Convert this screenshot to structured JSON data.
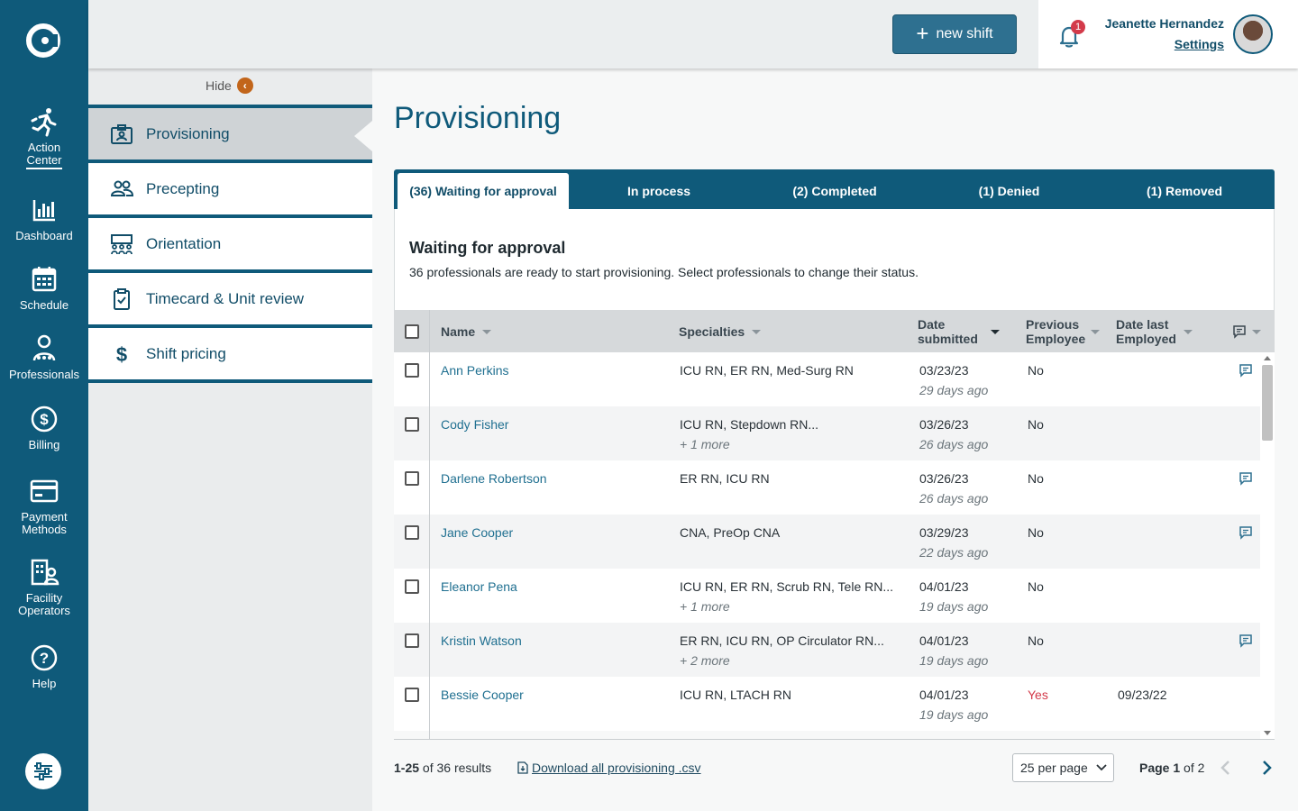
{
  "rail": {
    "items": [
      {
        "label_1": "Action",
        "label_2": "Center",
        "icon": "running-person-icon"
      },
      {
        "label_1": "Dashboard",
        "icon": "bar-chart-icon"
      },
      {
        "label_1": "Schedule",
        "icon": "calendar-icon"
      },
      {
        "label_1": "Professionals",
        "icon": "people-icon"
      },
      {
        "label_1": "Billing",
        "icon": "dollar-icon"
      },
      {
        "label_1": "Payment",
        "label_2": "Methods",
        "icon": "credit-card-icon"
      },
      {
        "label_1": "Facility",
        "label_2": "Operators",
        "icon": "building-person-icon"
      },
      {
        "label_1": "Help",
        "icon": "help-icon"
      }
    ]
  },
  "header": {
    "new_shift_label": "new shift",
    "notification_count": "1",
    "user_name": "Jeanette Hernandez",
    "settings_label": "Settings"
  },
  "subnav": {
    "hide_label": "Hide",
    "items": [
      {
        "label": "Provisioning",
        "icon": "id-badge-icon",
        "active": true
      },
      {
        "label": "Precepting",
        "icon": "two-people-icon"
      },
      {
        "label": "Orientation",
        "icon": "group-icon"
      },
      {
        "label": "Timecard & Unit review",
        "icon": "clipboard-check-icon"
      },
      {
        "label": "Shift pricing",
        "icon": "dollar-sign-icon"
      }
    ]
  },
  "main": {
    "title": "Provisioning",
    "tabs": [
      {
        "label": "(36) Waiting for approval",
        "active": true
      },
      {
        "label": "In process"
      },
      {
        "label": "(2) Completed"
      },
      {
        "label": "(1) Denied"
      },
      {
        "label": "(1) Removed"
      }
    ],
    "panel_title": "Waiting for approval",
    "panel_text": "36 professionals are ready to start provisioning. Select professionals to change their status."
  },
  "table": {
    "headers": {
      "name": "Name",
      "specialties": "Specialties",
      "date_submitted_1": "Date",
      "date_submitted_2": "submitted",
      "previous_1": "Previous",
      "previous_2": "Employee",
      "last_employed_1": "Date last",
      "last_employed_2": "Employed"
    },
    "rows": [
      {
        "name": "Ann Perkins",
        "specialties": "ICU RN, ER RN, Med-Surg RN",
        "more": "",
        "date": "03/23/23",
        "ago": "29 days ago",
        "previous": "No",
        "last_employed": "",
        "has_note": true
      },
      {
        "name": "Cody Fisher",
        "specialties": "ICU RN, Stepdown RN...",
        "more": "+ 1 more",
        "date": "03/26/23",
        "ago": "26 days ago",
        "previous": "No",
        "last_employed": "",
        "has_note": false
      },
      {
        "name": "Darlene Robertson",
        "specialties": "ER RN, ICU RN",
        "more": "",
        "date": "03/26/23",
        "ago": "26 days ago",
        "previous": "No",
        "last_employed": "",
        "has_note": true
      },
      {
        "name": "Jane Cooper",
        "specialties": "CNA, PreOp CNA",
        "more": "",
        "date": "03/29/23",
        "ago": "22 days ago",
        "previous": "No",
        "last_employed": "",
        "has_note": true
      },
      {
        "name": "Eleanor Pena",
        "specialties": "ICU RN, ER RN, Scrub RN, Tele RN...",
        "more": "+ 1 more",
        "date": "04/01/23",
        "ago": "19 days ago",
        "previous": "No",
        "last_employed": "",
        "has_note": false
      },
      {
        "name": "Kristin Watson",
        "specialties": "ER RN, ICU RN, OP Circulator RN...",
        "more": "+ 2 more",
        "date": "04/01/23",
        "ago": "19 days ago",
        "previous": "No",
        "last_employed": "",
        "has_note": true
      },
      {
        "name": "Bessie Cooper",
        "specialties": "ICU RN, LTACH RN",
        "more": "",
        "date": "04/01/23",
        "ago": "19 days ago",
        "previous": "Yes",
        "last_employed": "09/23/22",
        "has_note": false
      }
    ]
  },
  "footer": {
    "range": "1-25",
    "of_results": "of 36 results",
    "download_label": "Download all provisioning .csv",
    "per_page": "25 per page",
    "page_label": "Page",
    "page_current": "1",
    "page_of": "of 2"
  },
  "colors": {
    "brand": "#0f5a7a",
    "accent_orange": "#c2651a",
    "alert_red": "#d33a4a"
  }
}
